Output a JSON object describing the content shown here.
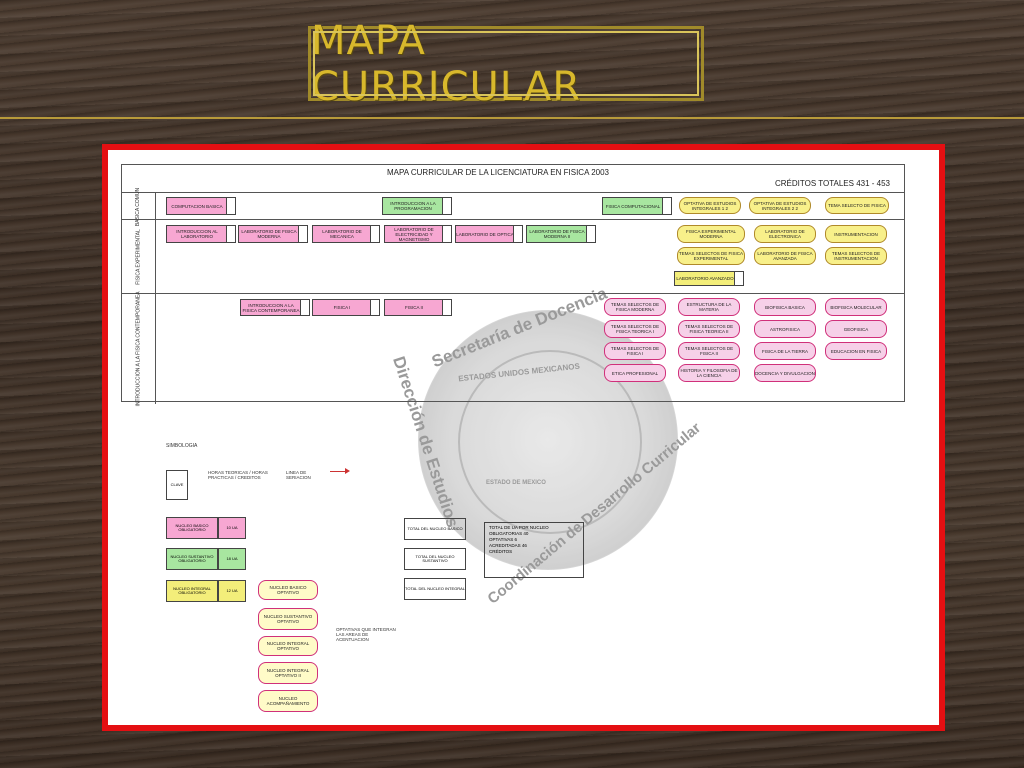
{
  "header": {
    "title": "MAPA CURRICULAR"
  },
  "document": {
    "title": "MAPA CURRICULAR DE LA LICENCIATURA EN FISICA 2003",
    "credits": "CRÉDITOS TOTALES 431 - 453",
    "row_labels": [
      "BASICA COMUN",
      "FISICA EXPERIMENTAL",
      "INTRODUCCION A LA FISICA CONTEMPORANEA"
    ],
    "row1_boxes": [
      "COMPUTACION BASICA",
      "INTRODUCCION A LA PROGRAMACION",
      "FISICA COMPUTACIONAL"
    ],
    "row1_ovals": [
      "OPTATIVA DE ESTUDIOS INTEGRALES 1 2",
      "OPTATIVA DE ESTUDIOS INTEGRALES 2 2",
      "TEMA SELECTO DE FISICA"
    ],
    "row2_boxes": [
      "INTRODUCCION AL LABORATORIO",
      "LABORATORIO DE FISICA MODERNA",
      "LABORATORIO DE MECANICA",
      "LABORATORIO DE ELECTRICIDAD Y MAGNETISMO",
      "LABORATORIO DE OPTICA",
      "LABORATORIO DE FISICA MODERNA II"
    ],
    "row2_ovals": [
      "FISICA EXPERIMENTAL MODERNA",
      "LABORATORIO DE ELECTRONICA",
      "INSTRUMENTACION",
      "TEMAS SELECTOS DE FISICA EXPERIMENTAL",
      "LABORATORIO DE FISICA AVANZADA",
      "TEMAS SELECTOS DE INSTRUMENTACION"
    ],
    "row2_extra": "LABORATORIO AVANZADO",
    "row3_boxes": [
      "INTRODUCCION A LA FISICA CONTEMPORANEA",
      "FISICA I",
      "FISICA II"
    ],
    "row3_ovals": [
      "TEMAS SELECTOS DE FISICA MODERNA",
      "ESTRUCTURA DE LA MATERIA",
      "BIOFISICA BASICA",
      "BIOFISICA MOLECULAR",
      "TEMAS SELECTOS DE FISICA TEORICA I",
      "TEMAS SELECTOS DE FISICA TEORICA II",
      "ASTROFISICA",
      "GEOFISICA",
      "TEMAS SELECTOS DE FISICA I",
      "TEMAS SELECTOS DE FISICA II",
      "FISICA DE LA TIERRA",
      "EDUCACION EN FISICA",
      "ETICA PROFESIONAL",
      "HISTORIA Y FILOSOFIA DE LA CIENCIA",
      "DOCENCIA Y DIVULGACION"
    ],
    "watermark": [
      "Secretaría de Docencia",
      "Dirección de Estudios",
      "Coordinación de Desarrollo Curricular",
      "ESTADOS UNIDOS MEXICANOS",
      "ESTADO DE MEXICO"
    ],
    "legend": {
      "title": "SIMBOLOGIA",
      "key_label": "CLAVE",
      "key_text": "HORAS TEORICAS / HORAS PRACTICAS / CREDITOS",
      "key_aside": "LINEA DE SERIACION",
      "core_rows": [
        {
          "label": "NUCLEO BASICO OBLIGATORIO",
          "value": "10 UA"
        },
        {
          "label": "NUCLEO SUSTANTIVO OBLIGATORIO",
          "value": "18 UA"
        },
        {
          "label": "NUCLEO INTEGRAL OBLIGATORIO",
          "value": "12 UA"
        }
      ],
      "pink_oval_labels": [
        "NUCLEO BASICO OPTATIVO",
        "NUCLEO SUSTANTIVO OPTATIVO",
        "NUCLEO INTEGRAL OPTATIVO",
        "NUCLEO INTEGRAL OPTATIVO II",
        "NUCLEO ACOMPAÑAMIENTO"
      ],
      "oval_note": "OPTATIVAS QUE INTEGRAN LAS AREAS DE ACENTUACION",
      "mid_boxes": [
        "TOTAL DEL NUCLEO BASICO",
        "TOTAL DEL NUCLEO SUSTANTIVO",
        "TOTAL DEL NUCLEO INTEGRAL"
      ],
      "summary_title": "TOTAL DE UA POR NUCLEO",
      "summary_rows": [
        "OBLIGATORIAS 40",
        "OPTATIVAS 6",
        "ACREDITADAS 46"
      ],
      "summary_footer": "CRÉDITOS"
    }
  }
}
